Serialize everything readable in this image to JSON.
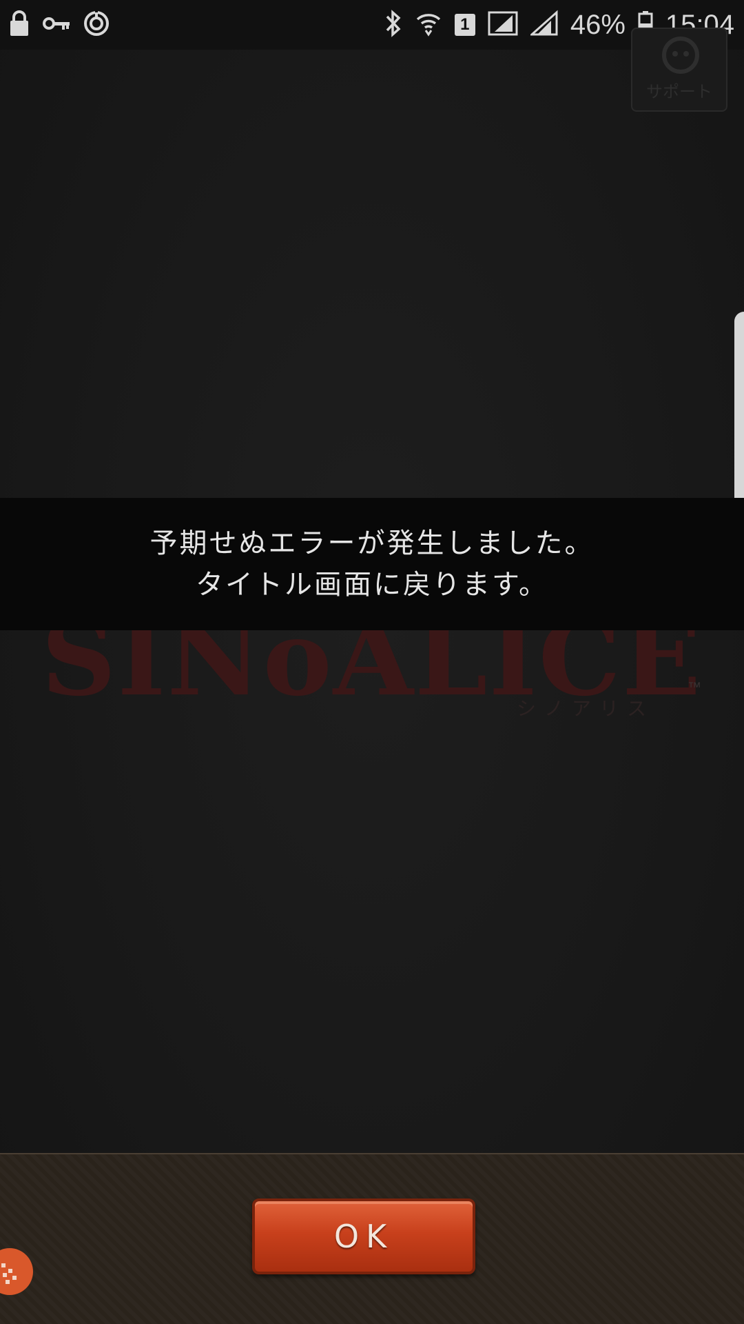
{
  "status_bar": {
    "battery_percent": "46%",
    "time": "15:04",
    "sim_slot": "1",
    "icons": [
      "lock-icon",
      "key-icon",
      "sync-icon",
      "bluetooth-icon",
      "wifi-icon",
      "sim-icon",
      "signal-icon",
      "signal-icon",
      "battery-icon"
    ]
  },
  "support": {
    "label": "サポート",
    "icon": "support-icon"
  },
  "logo": {
    "title": "SINoALICE",
    "subtitle": "シノアリス",
    "trademark": "™"
  },
  "error": {
    "line1": "予期せぬエラーが発生しました。",
    "line2": "タイトル画面に戻ります。"
  },
  "dialog": {
    "ok_label": "OK"
  },
  "colors": {
    "banner_bg": "#080808",
    "button_accent": "#c8401c",
    "panel_bg": "#2b241c",
    "logo_red": "#3a1717"
  }
}
